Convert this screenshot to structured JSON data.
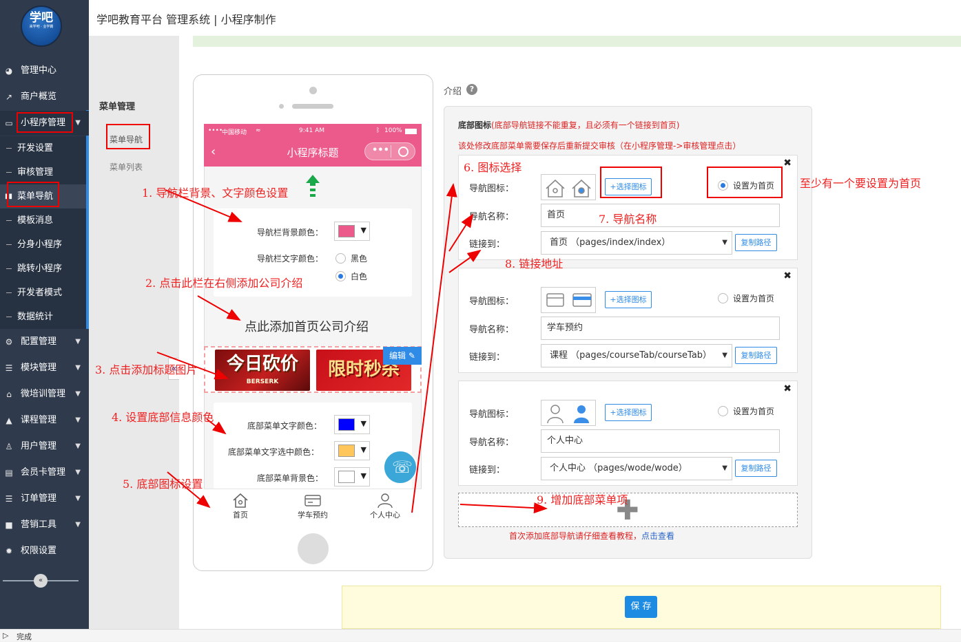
{
  "logo": {
    "text": "学吧",
    "slogan": "来学吧 · 业学霸"
  },
  "sidebar": {
    "items": [
      {
        "label": "管理中心",
        "icon": "dashboard-icon"
      },
      {
        "label": "商户概览",
        "icon": "chart-line-icon"
      },
      {
        "label": "小程序管理",
        "icon": "monitor-icon"
      },
      {
        "label": "配置管理",
        "icon": "cogs-icon"
      },
      {
        "label": "模块管理",
        "icon": "list-icon"
      },
      {
        "label": "微培训管理",
        "icon": "home-icon"
      },
      {
        "label": "课程管理",
        "icon": "graduation-cap-icon"
      },
      {
        "label": "用户管理",
        "icon": "user-icon"
      },
      {
        "label": "会员卡管理",
        "icon": "card-icon"
      },
      {
        "label": "订单管理",
        "icon": "list-icon"
      },
      {
        "label": "营销工具",
        "icon": "briefcase-icon"
      },
      {
        "label": "权限设置",
        "icon": "gear-icon"
      }
    ],
    "submenu": [
      "开发设置",
      "审核管理",
      "菜单导航",
      "模板消息",
      "分身小程序",
      "跳转小程序",
      "开发者模式",
      "数据统计"
    ]
  },
  "header": {
    "title": "学吧教育平台 管理系统 | 小程序制作"
  },
  "menu_panel": {
    "heading": "菜单管理",
    "nav": "菜单导航",
    "list": "菜单列表"
  },
  "phone": {
    "status_carrier": "中国移动",
    "status_time": "9:41 AM",
    "status_battery": "100%",
    "title": "小程序标题",
    "nav_bg_label": "导航栏背景颜色：",
    "nav_text_label": "导航栏文字颜色：",
    "black": "黑色",
    "white": "白色",
    "add_intro": "点此添加首页公司介绍",
    "banner1": "今日砍价",
    "banner1_sub": "BERSERK",
    "banner2": "限时秒杀",
    "edit": "编辑",
    "bottom_text_label": "底部菜单文字颜色：",
    "bottom_selected_label": "底部菜单文字选中颜色：",
    "bottom_bg_label": "底部菜单背景色：",
    "tabs": [
      "首页",
      "学车预约",
      "个人中心"
    ],
    "colors": {
      "nav_bg": "#eb5a8a",
      "text": "#0000ff",
      "selected": "#ffc65c",
      "bg": "#ffffff"
    }
  },
  "right": {
    "intro_label": "介绍",
    "title": "底部图标",
    "title_note": "(底部导航链接不能重复，且必须有一个链接到首页)",
    "warning": "该处修改底部菜单需要保存后重新提交审核（在小程序管理->审核管理点击）",
    "icon_label": "导航图标：",
    "name_label": "导航名称：",
    "link_label": "链接到：",
    "pick_icon": "+选择图标",
    "set_home": "设置为首页",
    "copy_path": "复制路径",
    "items": [
      {
        "name": "首页",
        "link": "首页 （pages/index/index）",
        "home": true
      },
      {
        "name": "学车预约",
        "link": "课程 （pages/courseTab/courseTab）",
        "home": false
      },
      {
        "name": "个人中心",
        "link": "个人中心 （pages/wode/wode）",
        "home": false
      }
    ],
    "first_note": "首次添加底部导航请仔细查看教程，",
    "first_link": "点击查看"
  },
  "save": "保 存",
  "status": "完成",
  "annotations": {
    "n1": "1. 导航栏背景、文字颜色设置",
    "n2": "2. 点击此栏在右侧添加公司介绍",
    "n3": "3. 点击添加标题图片",
    "n4": "4. 设置底部信息颜色",
    "n5": "5. 底部图标设置",
    "n6": "6. 图标选择",
    "n7": "7. 导航名称",
    "n8": "8. 链接地址",
    "n9": "9. 增加底部菜单项",
    "n10": "至少有一个要设置为首页"
  }
}
